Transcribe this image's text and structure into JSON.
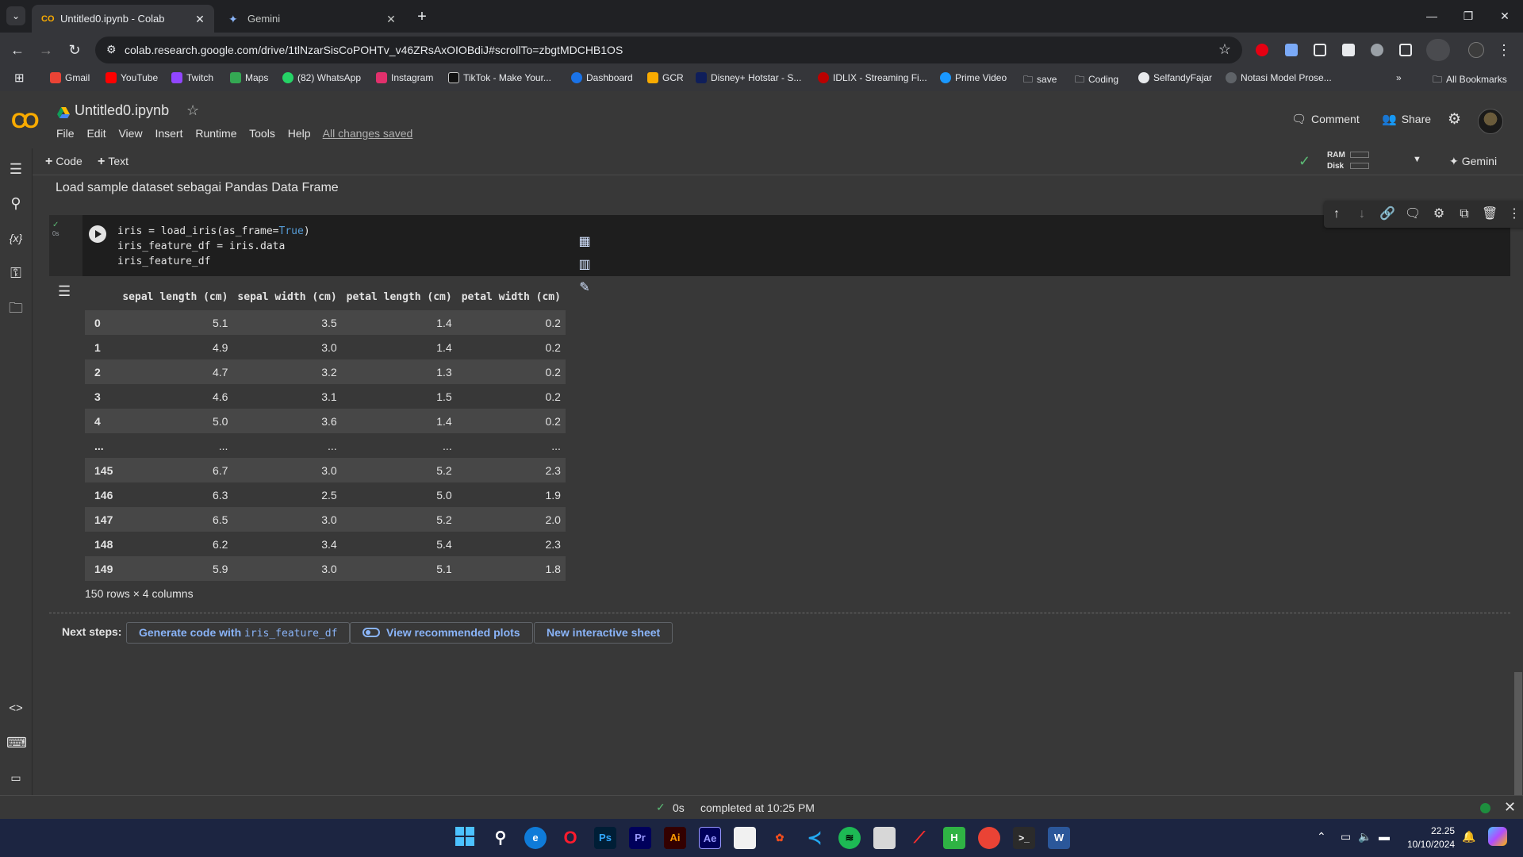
{
  "browser": {
    "tabs": [
      {
        "label": "Untitled0.ipynb - Colab",
        "active": true
      },
      {
        "label": "Gemini",
        "active": false
      }
    ],
    "url": "colab.research.google.com/drive/1tlNzarSisCoPOHTv_v46ZRsAxOIOBdiJ#scrollTo=zbgtMDCHB1OS",
    "bookmarks": [
      "Gmail",
      "YouTube",
      "Twitch",
      "Maps",
      "(82) WhatsApp",
      "Instagram",
      "TikTok - Make Your...",
      "Dashboard",
      "GCR",
      "Disney+ Hotstar - S...",
      "IDLIX - Streaming Fi...",
      "Prime Video",
      "save",
      "Coding",
      "SelfandyFajar",
      "Notasi Model Prose..."
    ],
    "all_bookmarks": "All Bookmarks"
  },
  "colab": {
    "logo": "CO",
    "title": "Untitled0.ipynb",
    "menu": [
      "File",
      "Edit",
      "View",
      "Insert",
      "Runtime",
      "Tools",
      "Help"
    ],
    "save_status": "All changes saved",
    "comment_label": "Comment",
    "share_label": "Share"
  },
  "nb_toolbar": {
    "code_label": "Code",
    "text_label": "Text",
    "ram_label": "RAM",
    "disk_label": "Disk",
    "gemini_label": "Gemini"
  },
  "notebook": {
    "text_cell": "Load sample dataset sebagai Pandas Data Frame",
    "exec_time": "0s",
    "code": {
      "line1_prefix": "iris = load_iris(as_frame=",
      "line1_kw": "True",
      "line1_suffix": ")",
      "line2": "iris_feature_df = iris.data",
      "line3": "iris_feature_df"
    },
    "dataframe": {
      "columns": [
        "",
        "sepal length (cm)",
        "sepal width (cm)",
        "petal length (cm)",
        "petal width (cm)"
      ],
      "rows": [
        [
          "0",
          "5.1",
          "3.5",
          "1.4",
          "0.2"
        ],
        [
          "1",
          "4.9",
          "3.0",
          "1.4",
          "0.2"
        ],
        [
          "2",
          "4.7",
          "3.2",
          "1.3",
          "0.2"
        ],
        [
          "3",
          "4.6",
          "3.1",
          "1.5",
          "0.2"
        ],
        [
          "4",
          "5.0",
          "3.6",
          "1.4",
          "0.2"
        ],
        [
          "...",
          "...",
          "...",
          "...",
          "..."
        ],
        [
          "145",
          "6.7",
          "3.0",
          "5.2",
          "2.3"
        ],
        [
          "146",
          "6.3",
          "2.5",
          "5.0",
          "1.9"
        ],
        [
          "147",
          "6.5",
          "3.0",
          "5.2",
          "2.0"
        ],
        [
          "148",
          "6.2",
          "3.4",
          "5.4",
          "2.3"
        ],
        [
          "149",
          "5.9",
          "3.0",
          "5.1",
          "1.8"
        ]
      ],
      "caption": "150 rows × 4 columns"
    },
    "next_steps": {
      "label": "Next steps:",
      "generate_prefix": "Generate code with ",
      "generate_code": "iris_feature_df",
      "plots": "View recommended plots",
      "sheet": "New interactive sheet"
    }
  },
  "status_bar": {
    "time": "0s",
    "message": "completed at 10:25 PM"
  },
  "taskbar": {
    "clock_time": "22.25",
    "clock_date": "10/10/2024"
  },
  "colors": {
    "accent_link": "#8ab4f8",
    "success": "#5bb974",
    "colab_orange": "#f9ab00",
    "taskbar": "#1c2541"
  }
}
